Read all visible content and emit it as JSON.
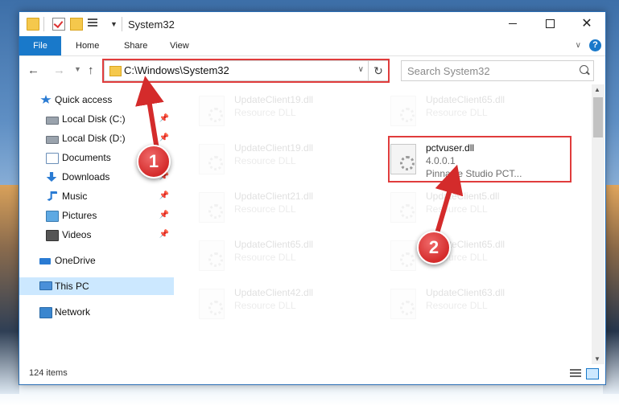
{
  "window": {
    "title": "System32"
  },
  "ribbon": {
    "tabs": [
      "File",
      "Home",
      "Share",
      "View"
    ],
    "help": "?"
  },
  "nav": {
    "address": "C:\\Windows\\System32",
    "search_placeholder": "Search System32"
  },
  "sidebar": {
    "items": [
      {
        "label": "Quick access",
        "icon": "star-icon",
        "pinned": false
      },
      {
        "label": "Local Disk (C:)",
        "icon": "disk-icon",
        "pinned": true
      },
      {
        "label": "Local Disk (D:)",
        "icon": "disk-icon",
        "pinned": true
      },
      {
        "label": "Documents",
        "icon": "documents-icon",
        "pinned": true
      },
      {
        "label": "Downloads",
        "icon": "download-icon",
        "pinned": true
      },
      {
        "label": "Music",
        "icon": "music-icon",
        "pinned": true
      },
      {
        "label": "Pictures",
        "icon": "pictures-icon",
        "pinned": true
      },
      {
        "label": "Videos",
        "icon": "videos-icon",
        "pinned": true
      },
      {
        "label": "OneDrive",
        "icon": "cloud-icon",
        "pinned": false
      },
      {
        "label": "This PC",
        "icon": "computer-icon",
        "pinned": false,
        "selected": true
      },
      {
        "label": "Network",
        "icon": "network-icon",
        "pinned": false
      }
    ]
  },
  "files": {
    "left": [
      {
        "name": "UpdateClient19.dll",
        "desc": "Resource DLL"
      },
      {
        "name": "UpdateClient19.dll",
        "desc": "Resource DLL"
      },
      {
        "name": "UpdateClient21.dll",
        "desc": "Resource DLL"
      },
      {
        "name": "UpdateClient65.dll",
        "desc": "Resource DLL"
      },
      {
        "name": "UpdateClient42.dll",
        "desc": "Resource DLL"
      }
    ],
    "right": [
      {
        "name": "UpdateClient65.dll",
        "desc": "Resource DLL"
      },
      {
        "name": "pctvuser.dll",
        "desc": "4.0.0.1",
        "desc2": "Pinnacle Studio PCT..."
      },
      {
        "name": "UpdateClient5.dll",
        "desc": "Resource DLL"
      },
      {
        "name": "UpdateClient65.dll",
        "desc": "Resource DLL"
      },
      {
        "name": "UpdateClient63.dll",
        "desc": "Resource DLL"
      }
    ]
  },
  "status": {
    "count": "124 items"
  },
  "callouts": {
    "one": "1",
    "two": "2"
  },
  "colors": {
    "accent": "#1979ca",
    "highlight": "#e03c3c",
    "selected": "#cce8ff"
  }
}
